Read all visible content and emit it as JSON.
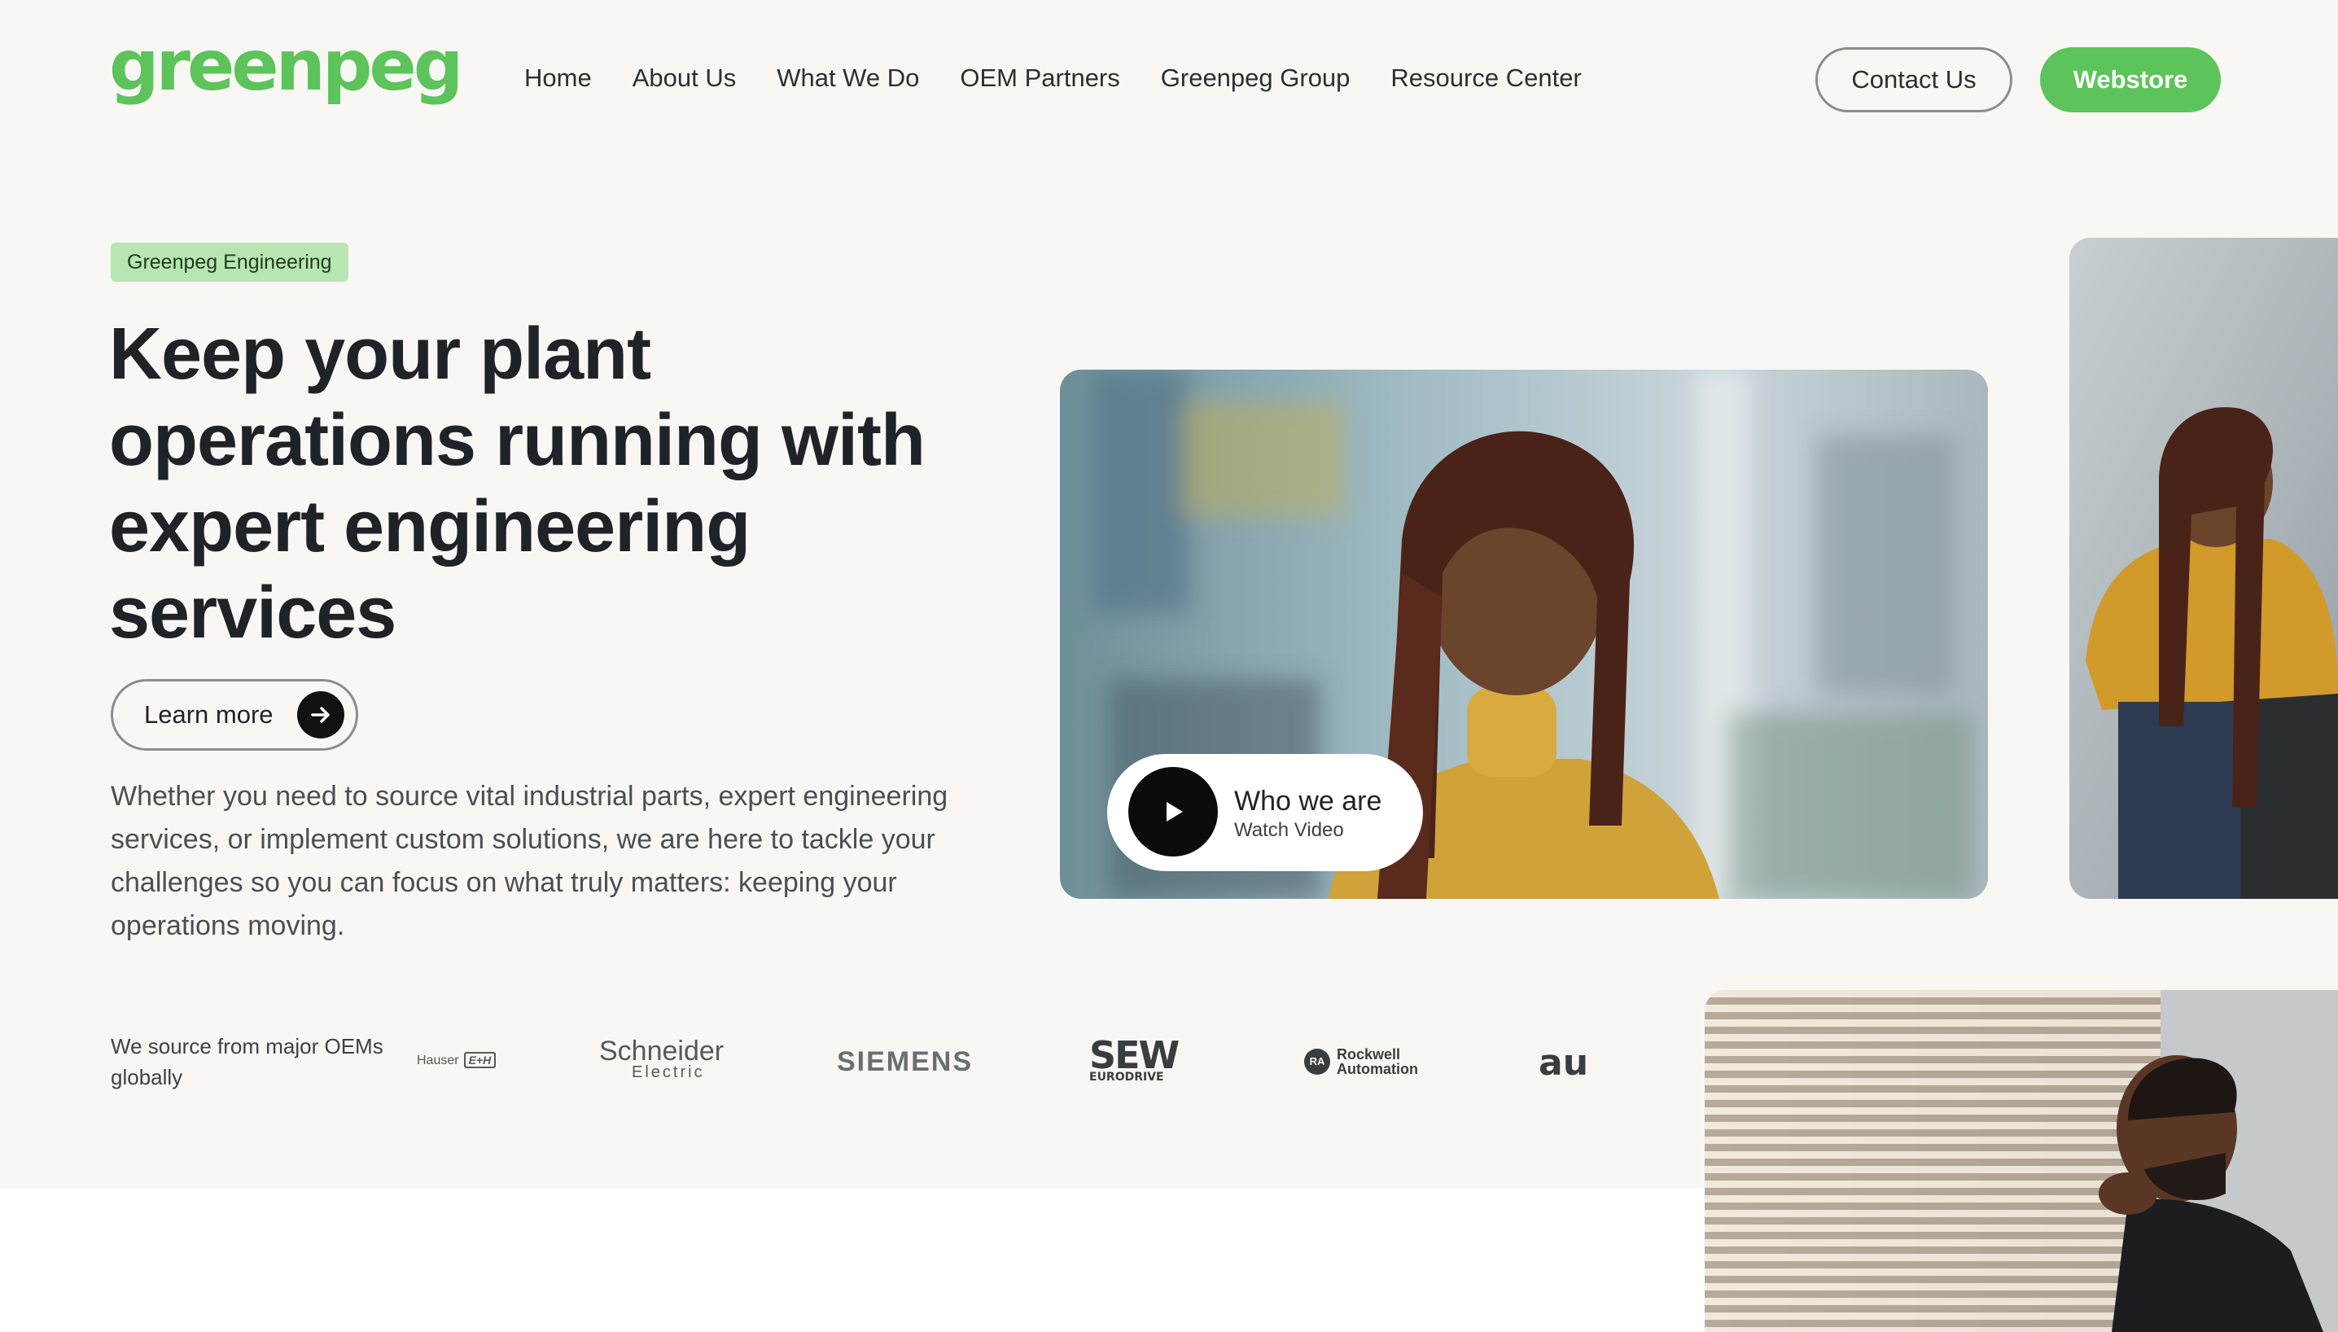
{
  "header": {
    "logo": "greenpeg",
    "nav": [
      "Home",
      "About Us",
      "What We Do",
      "OEM Partners",
      "Greenpeg Group",
      "Resource Center"
    ],
    "contact_label": "Contact Us",
    "webstore_label": "Webstore"
  },
  "hero": {
    "badge": "Greenpeg Engineering",
    "title": "Keep your plant operations running with expert engineering services",
    "learn_more_label": "Learn more",
    "description": "Whether you need to source vital industrial parts, expert engineering services, or implement custom solutions, we are here to tackle your challenges so you can focus on what truly matters: keeping your operations moving."
  },
  "video": {
    "title": "Who we are",
    "subtitle": "Watch Video"
  },
  "oem": {
    "label": "We source from major OEMs globally",
    "logos": {
      "hauser": "Hauser",
      "hauser_mark": "E+H",
      "schneider": "Schneider",
      "schneider_sub": "Electric",
      "siemens": "SIEMENS",
      "sew": "SEW",
      "sew_sub": "EURODRIVE",
      "rockwell_mark": "RA",
      "rockwell_1": "Rockwell",
      "rockwell_2": "Automation",
      "au": "au"
    }
  },
  "colors": {
    "brand_green": "#5cc45a",
    "badge_green": "#b8e6b2",
    "hero_background": "#f8f7f4",
    "text_dark": "#1f2328"
  },
  "icons": {
    "learn_more": "arrow-right-icon",
    "video": "play-icon"
  }
}
